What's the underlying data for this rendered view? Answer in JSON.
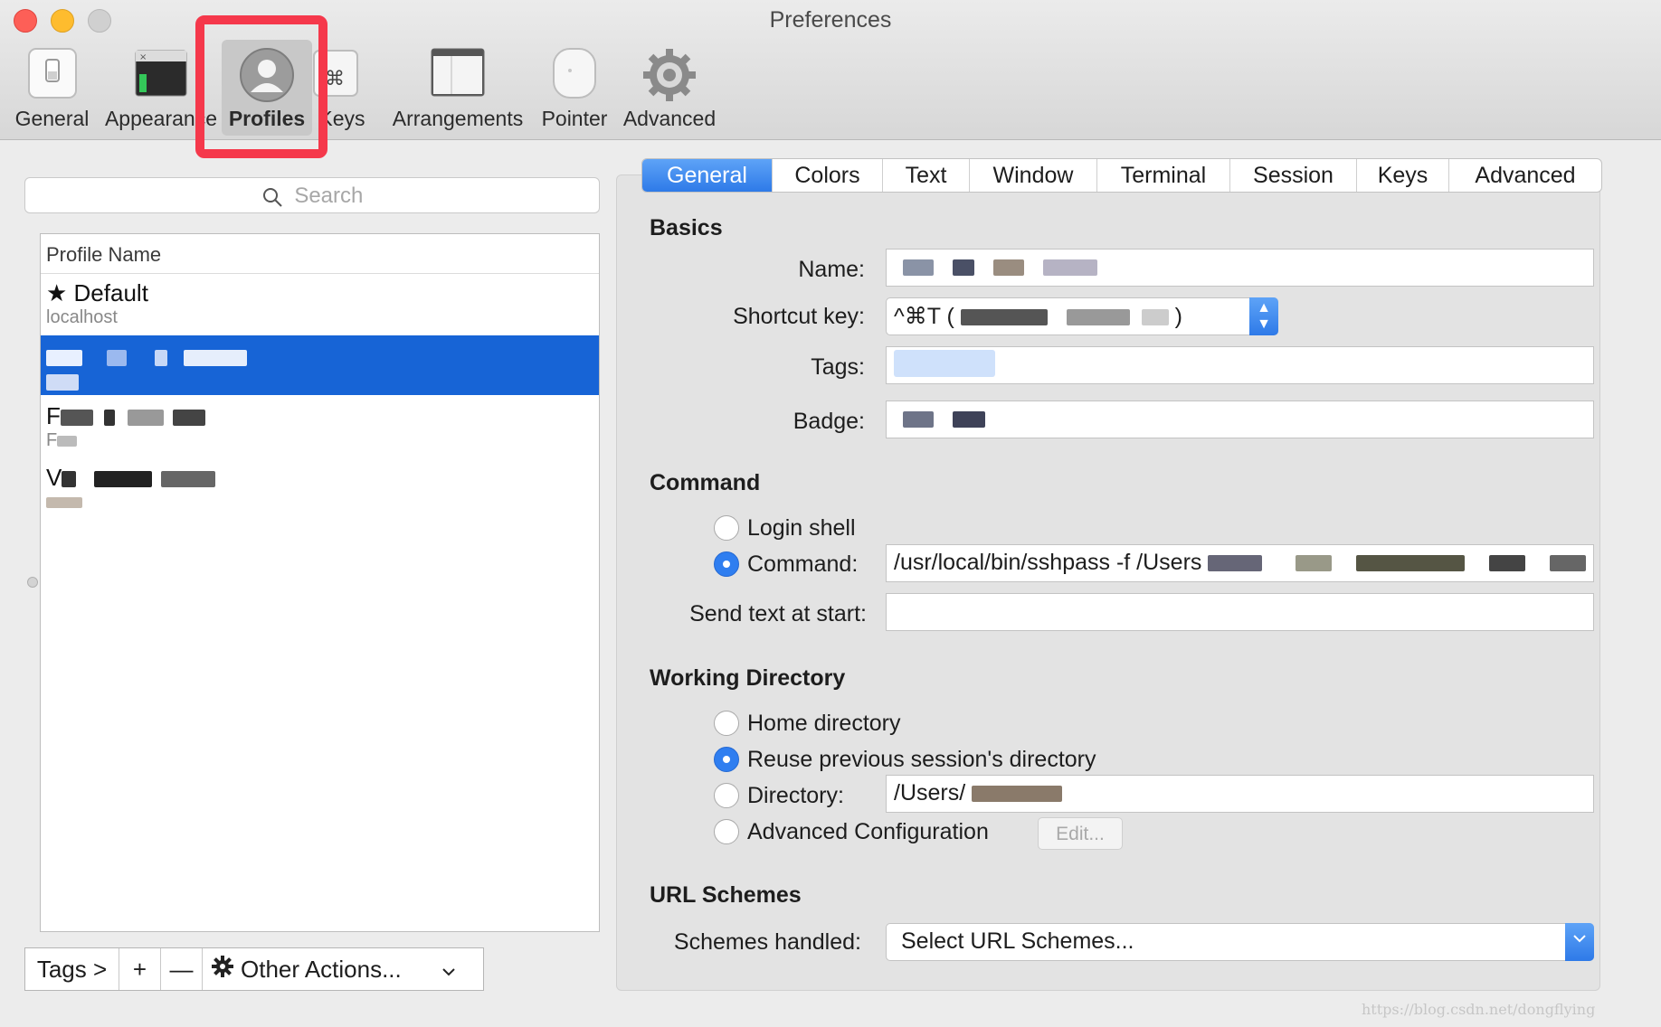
{
  "window": {
    "title": "Preferences"
  },
  "toolbar": {
    "items": [
      {
        "label": "General",
        "icon": "general-switch-icon"
      },
      {
        "label": "Appearance",
        "icon": "appearance-terminal-icon"
      },
      {
        "label": "Profiles",
        "icon": "profiles-person-icon",
        "selected": true
      },
      {
        "label": "Keys",
        "icon": "keys-command-icon"
      },
      {
        "label": "Arrangements",
        "icon": "arrangements-window-icon"
      },
      {
        "label": "Pointer",
        "icon": "pointer-mouse-icon"
      },
      {
        "label": "Advanced",
        "icon": "advanced-gear-icon"
      }
    ],
    "highlight_color": "#f5384b"
  },
  "left": {
    "search_placeholder": "Search",
    "list_header": "Profile Name",
    "profiles": [
      {
        "title": "★ Default",
        "subtitle": "localhost"
      },
      {
        "title": "",
        "subtitle": "",
        "selected": true,
        "redacted": true
      },
      {
        "title": "F",
        "subtitle": "F",
        "redacted": true
      },
      {
        "title": "V",
        "subtitle": "",
        "redacted": true
      }
    ],
    "bottom": {
      "tags": "Tags >",
      "add": "+",
      "remove": "—",
      "other_actions": "Other Actions..."
    }
  },
  "right": {
    "tabs": [
      "General",
      "Colors",
      "Text",
      "Window",
      "Terminal",
      "Session",
      "Keys",
      "Advanced"
    ],
    "active_tab": "General",
    "basics": {
      "title": "Basics",
      "name_label": "Name:",
      "shortcut_label": "Shortcut key:",
      "shortcut_value": "^⌘T (",
      "shortcut_close": ")",
      "tags_label": "Tags:",
      "badge_label": "Badge:"
    },
    "command": {
      "title": "Command",
      "login_shell": "Login shell",
      "command_label": "Command:",
      "command_value": "/usr/local/bin/sshpass -f /Users",
      "send_text_label": "Send text at start:"
    },
    "working_dir": {
      "title": "Working Directory",
      "home": "Home directory",
      "reuse": "Reuse previous session's directory",
      "directory_label": "Directory:",
      "directory_value": "/Users/",
      "advanced": "Advanced Configuration",
      "edit": "Edit..."
    },
    "url": {
      "title": "URL Schemes",
      "schemes_label": "Schemes handled:",
      "schemes_value": "Select URL Schemes..."
    }
  },
  "watermark": "https://blog.csdn.net/dongflying",
  "colors": {
    "accent": "#2f7ef0",
    "selection": "#1764d6"
  }
}
